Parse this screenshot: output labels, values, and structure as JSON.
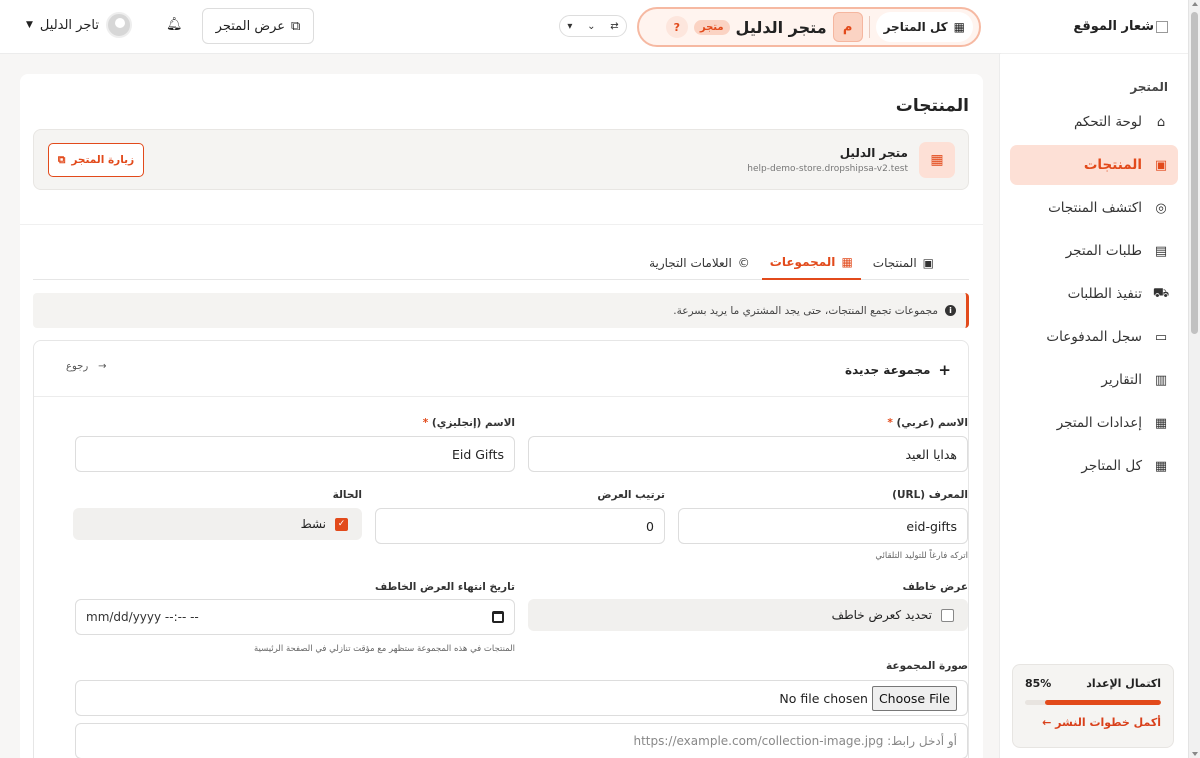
{
  "sidebar": {
    "logo_text": "شعار الموقع",
    "section": "المتجر",
    "items": [
      {
        "label": "لوحة التحكم",
        "icon": "home-icon",
        "glyph": "⌂"
      },
      {
        "label": "المنتجات",
        "icon": "box-icon",
        "glyph": "▣"
      },
      {
        "label": "اكتشف المنتجات",
        "icon": "compass-icon",
        "glyph": "◎"
      },
      {
        "label": "طلبات المتجر",
        "icon": "receipt-icon",
        "glyph": "▤"
      },
      {
        "label": "تنفيذ الطلبات",
        "icon": "truck-icon",
        "glyph": "⛟"
      },
      {
        "label": "سجل المدفوعات",
        "icon": "money-icon",
        "glyph": "▭"
      },
      {
        "label": "التقارير",
        "icon": "chart-icon",
        "glyph": "▥"
      },
      {
        "label": "إعدادات المتجر",
        "icon": "store-icon",
        "glyph": "▦"
      },
      {
        "label": "كل المتاجر",
        "icon": "grid-icon",
        "glyph": "▦"
      }
    ],
    "setup": {
      "title": "اكتمال الإعداد",
      "percent_label": "85%",
      "progress": 0.85,
      "link": "أكمل خطوات النشر ←"
    }
  },
  "header": {
    "all_stores": "كل المتاجر",
    "store_initial": "م",
    "store_name": "متجر الدليل",
    "store_badge": "متجر",
    "help": "?",
    "view_store": "عرض المتجر",
    "user_name": "تاجر الدليل"
  },
  "page": {
    "title": "المنتجات",
    "store_name": "متجر الدليل",
    "store_url": "help-demo-store.dropshipsa-v2.test",
    "visit_store": "زيارة المتجر",
    "tabs": [
      {
        "label": "المنتجات",
        "icon": "box-icon",
        "glyph": "▣"
      },
      {
        "label": "المجموعات",
        "icon": "grid-icon",
        "glyph": "▦"
      },
      {
        "label": "العلامات التجارية",
        "icon": "copyright-icon",
        "glyph": "©"
      }
    ],
    "info": "مجموعات تجمع المنتجات، حتى يجد المشتري ما يريد بسرعة."
  },
  "form": {
    "title": "مجموعة جديدة",
    "back": "رجوع",
    "name_ar_label": "الاسم (عربي)",
    "name_ar_value": "هدايا العيد",
    "name_en_label": "الاسم (إنجليزي)",
    "name_en_value": "Eid Gifts",
    "slug_label": "المعرف (URL)",
    "slug_value": "eid-gifts",
    "slug_hint": "اتركه فارغاً للتوليد التلقائي",
    "order_label": "ترتيب العرض",
    "order_value": "0",
    "status_label": "الحالة",
    "status_value": "نشط",
    "flash_label": "عرض خاطف",
    "flash_check": "تحديد كعرض خاطف",
    "flash_end_label": "تاريخ انتهاء العرض الخاطف",
    "flash_end_placeholder": "mm/dd/yyyy --:-- --",
    "flash_hint": "المنتجات في هذه المجموعة ستظهر مع مؤقت تنازلي في الصفحة الرئيسية",
    "image_label": "صورة المجموعة",
    "file_button": "Choose File",
    "file_status": "No file chosen",
    "image_url_placeholder": "أو أدخل رابط: https://example.com/collection-image.jpg"
  }
}
